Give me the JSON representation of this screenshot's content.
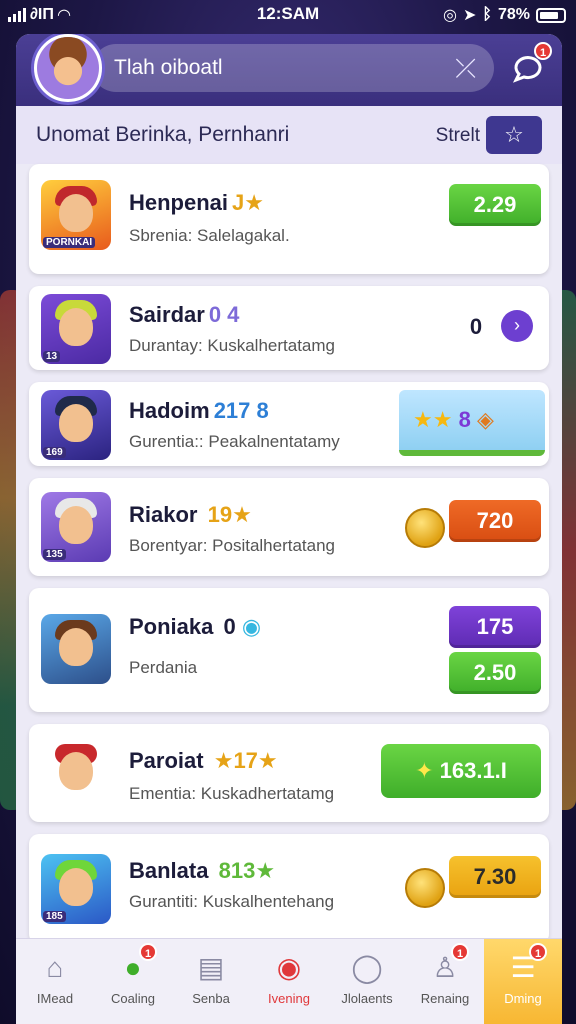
{
  "status": {
    "carrier": "∂ΙΠ",
    "time": "12:SAM",
    "battery": "78%"
  },
  "header": {
    "search_value": "Tlah oiboatl",
    "bell_badge": "1"
  },
  "section": {
    "title": "Unomat Berinka, Pernhanri",
    "sort_label": "Strelt"
  },
  "items": [
    {
      "name": "Henpenai",
      "tag": "J★",
      "sub": "Sbrenia: Salelagakal.",
      "thumb_label": "PORNKAI",
      "score": "2.29"
    },
    {
      "name": "Sairdar",
      "tag": "0 4",
      "sub": "Durantay:  Kuskalhertatamg",
      "thumb_label": "13",
      "score": "0"
    },
    {
      "name": "Hadoim",
      "tag": "217 8",
      "sub": "Gurentia::  Peakalnentatamy",
      "thumb_label": "169",
      "score": "8"
    },
    {
      "name": "Riakor",
      "tag": "19★",
      "sub": "Borentyar:  Positalhertatang",
      "thumb_label": "135",
      "score": "720"
    },
    {
      "name": "Poniaka",
      "tag": "0",
      "sub": "Perdania",
      "thumb_label": "",
      "score": "175",
      "score2": "2.50"
    },
    {
      "name": "Paroiat",
      "tag": "★17★",
      "sub": "Ementia:   Kuskadhertatamg",
      "thumb_label": "",
      "score": "163.1.I"
    },
    {
      "name": "Banlata",
      "tag": "813★",
      "sub": "Gurantiti:  Kuskalhentehang",
      "thumb_label": "185",
      "score": "7.30"
    }
  ],
  "nav": [
    {
      "label": "IMead",
      "badge": ""
    },
    {
      "label": "Coaling",
      "badge": "1"
    },
    {
      "label": "Senba",
      "badge": ""
    },
    {
      "label": "Ivening",
      "badge": ""
    },
    {
      "label": "Jlolaents",
      "badge": ""
    },
    {
      "label": "Renaing",
      "badge": "1"
    },
    {
      "label": "Dming",
      "badge": "1"
    }
  ],
  "colors": {
    "brand": "#3a2f7d",
    "accent_green": "#3fae2a",
    "accent_orange": "#d84d12",
    "accent_purple": "#5e2bb3"
  }
}
